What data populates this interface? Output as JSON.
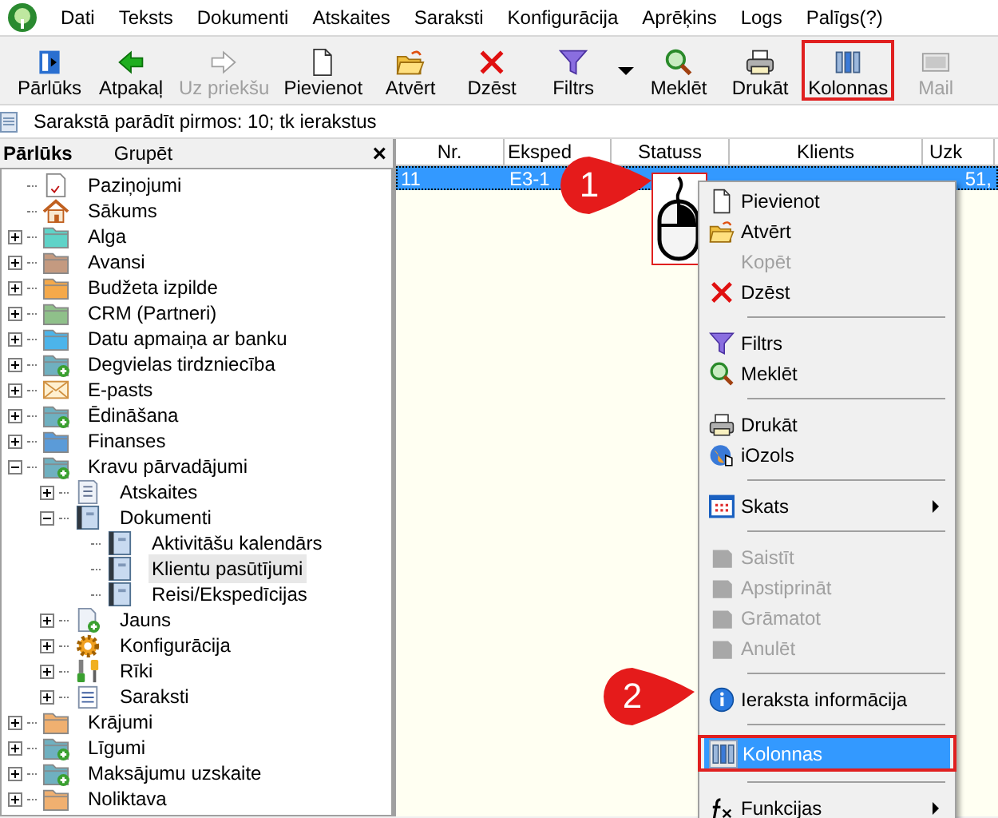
{
  "menu_bar": [
    "Dati",
    "Teksts",
    "Dokumenti",
    "Atskaites",
    "Saraksti",
    "Konfigurācija",
    "Aprēķins",
    "Logs",
    "Palīgs(?)"
  ],
  "toolbar": [
    {
      "kind": "browser",
      "label": "Pārlūks",
      "disabled": false,
      "highlighted": false
    },
    {
      "kind": "back",
      "label": "Atpakaļ",
      "disabled": false,
      "highlighted": false
    },
    {
      "kind": "forward",
      "label": "Uz priekšu",
      "disabled": true,
      "highlighted": false
    },
    {
      "kind": "new",
      "label": "Pievienot",
      "disabled": false,
      "highlighted": false
    },
    {
      "kind": "open",
      "label": "Atvērt",
      "disabled": false,
      "highlighted": false
    },
    {
      "kind": "delete",
      "label": "Dzēst",
      "disabled": false,
      "highlighted": false
    },
    {
      "kind": "filter",
      "label": "Filtrs",
      "disabled": false,
      "highlighted": false,
      "dropdown": true
    },
    {
      "kind": "search",
      "label": "Meklēt",
      "disabled": false,
      "highlighted": false
    },
    {
      "kind": "print",
      "label": "Drukāt",
      "disabled": false,
      "highlighted": false
    },
    {
      "kind": "columns",
      "label": "Kolonnas",
      "disabled": false,
      "highlighted": true
    },
    {
      "kind": "mail",
      "label": "Mail",
      "disabled": true,
      "highlighted": false
    }
  ],
  "info_line": "Sarakstā parādīt pirmos: 10; tk ierakstus",
  "browser_panel": {
    "tabs": [
      {
        "label": "Pārlūks",
        "selected": true
      },
      {
        "label": "Grupēt",
        "selected": false
      }
    ],
    "close": "×",
    "tree": [
      {
        "label": "Paziņojumi",
        "kind": "notice",
        "selected": false
      },
      {
        "label": "Sākums",
        "kind": "home",
        "selected": false
      },
      {
        "label": "Alga",
        "kind": "folder",
        "color": "#5fd3c8",
        "selected": false,
        "expanded": false
      },
      {
        "label": "Avansi",
        "kind": "folder",
        "color": "#c49a80",
        "selected": false,
        "expanded": false
      },
      {
        "label": "Budžeta izpilde",
        "kind": "folder",
        "color": "#f5a94a",
        "selected": false,
        "expanded": false
      },
      {
        "label": "CRM (Partneri)",
        "kind": "folder",
        "color": "#8fc08a",
        "selected": false,
        "expanded": false
      },
      {
        "label": "Datu apmaiņa ar banku",
        "kind": "folder",
        "color": "#4cb4ea",
        "selected": false,
        "expanded": false
      },
      {
        "label": "Degvielas tirdzniecība",
        "kind": "folder-plus",
        "color": "#6fb0c0",
        "selected": false,
        "expanded": false
      },
      {
        "label": "E-pasts",
        "kind": "mail",
        "selected": false,
        "expanded": false
      },
      {
        "label": "Ēdināšana",
        "kind": "folder-plus",
        "color": "#6fb0c0",
        "selected": false,
        "expanded": false
      },
      {
        "label": "Finanses",
        "kind": "folder",
        "color": "#5b9bd8",
        "selected": false,
        "expanded": false
      },
      {
        "label": "Kravu pārvadājumi",
        "kind": "folder-plus",
        "color": "#6fb0c0",
        "selected": false,
        "expanded": true,
        "children": [
          {
            "label": "Atskaites",
            "kind": "report",
            "selected": false,
            "expanded": false
          },
          {
            "label": "Dokumenti",
            "kind": "book",
            "selected": false,
            "expanded": true,
            "children": [
              {
                "label": "Aktivitāšu kalendārs",
                "kind": "book",
                "selected": false
              },
              {
                "label": "Klientu pasūtījumi",
                "kind": "book",
                "selected": true
              },
              {
                "label": "Reisi/Ekspedīcijas",
                "kind": "book",
                "selected": false
              }
            ]
          },
          {
            "label": "Jauns",
            "kind": "new",
            "selected": false,
            "expanded": false
          },
          {
            "label": "Konfigurācija",
            "kind": "gear",
            "selected": false,
            "expanded": false
          },
          {
            "label": "Rīki",
            "kind": "tools",
            "selected": false,
            "expanded": false
          },
          {
            "label": "Saraksti",
            "kind": "list",
            "selected": false,
            "expanded": false
          }
        ]
      },
      {
        "label": "Krājumi",
        "kind": "folder",
        "color": "#f0b070",
        "selected": false,
        "expanded": false
      },
      {
        "label": "Līgumi",
        "kind": "folder-plus",
        "color": "#6fb0c0",
        "selected": false,
        "expanded": false
      },
      {
        "label": "Maksājumu uzskaite",
        "kind": "folder-plus",
        "color": "#6fb0c0",
        "selected": false,
        "expanded": false
      },
      {
        "label": "Noliktava",
        "kind": "folder",
        "color": "#f0b070",
        "selected": false,
        "expanded": false
      }
    ]
  },
  "table": {
    "columns": [
      "Nr.",
      "Eksped",
      "Statuss",
      "Klients",
      "Uzk"
    ],
    "rows": [
      {
        "cells": [
          "11",
          "E3-1",
          "",
          "",
          "51,"
        ],
        "selected": true
      }
    ]
  },
  "context_menu": [
    {
      "kind": "item",
      "label": "Pievienot",
      "disabled": false,
      "selected": false
    },
    {
      "kind": "item",
      "label": "Atvērt",
      "disabled": false,
      "selected": false
    },
    {
      "kind": "item",
      "label": "Kopēt",
      "disabled": true,
      "selected": false
    },
    {
      "kind": "item",
      "label": "Dzēst",
      "disabled": false,
      "selected": false
    },
    {
      "kind": "separator"
    },
    {
      "kind": "item",
      "label": "Filtrs",
      "disabled": false,
      "selected": false
    },
    {
      "kind": "item",
      "label": "Meklēt",
      "disabled": false,
      "selected": false
    },
    {
      "kind": "separator"
    },
    {
      "kind": "item",
      "label": "Drukāt",
      "disabled": false,
      "selected": false
    },
    {
      "kind": "item",
      "label": "iOzols",
      "disabled": false,
      "selected": false
    },
    {
      "kind": "separator"
    },
    {
      "kind": "item",
      "label": "Skats",
      "disabled": false,
      "selected": false,
      "submenu": true
    },
    {
      "kind": "separator"
    },
    {
      "kind": "item",
      "label": "Saistīt",
      "disabled": true,
      "selected": false
    },
    {
      "kind": "item",
      "label": "Apstiprināt",
      "disabled": true,
      "selected": false
    },
    {
      "kind": "item",
      "label": "Grāmatot",
      "disabled": true,
      "selected": false
    },
    {
      "kind": "item",
      "label": "Anulēt",
      "disabled": true,
      "selected": false
    },
    {
      "kind": "separator"
    },
    {
      "kind": "item",
      "label": "Ieraksta informācija",
      "disabled": false,
      "selected": false
    },
    {
      "kind": "separator"
    },
    {
      "kind": "item",
      "label": "Kolonnas",
      "disabled": false,
      "selected": true,
      "highlighted": true
    },
    {
      "kind": "separator"
    },
    {
      "kind": "item",
      "label": "Funkcijas",
      "disabled": false,
      "selected": false,
      "submenu": true
    }
  ],
  "callouts": [
    "1",
    "2"
  ]
}
